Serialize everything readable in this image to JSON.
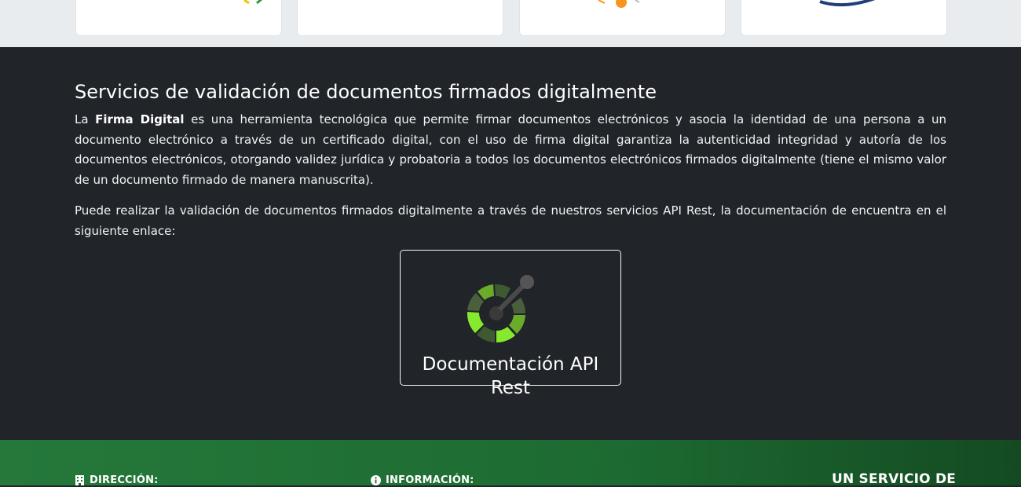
{
  "section": {
    "title": "Servicios de validación de documentos firmados digitalmente",
    "para1_prefix": "La ",
    "para1_bold": "Firma Digital",
    "para1_rest": " es una herramienta tecnológica que permite firmar documentos electrónicos y asocia la identidad de una persona a un documento electrónico a través de un certificado digital, con el uso de firma digital garantiza la autenticidad integridad y autoría de los documentos electrónicos, otorgando validez jurídica y probatoria a todos los documentos electrónicos firmados digitalmente (tiene el mismo valor de un documento firmado de manera manuscrita).",
    "para2": "Puede realizar la validación de documentos firmados digitalmente a través de nuestros servicios API Rest, la documentación de encuentra en el siguiente enlace:"
  },
  "api_button": {
    "label": "Documentación API Rest",
    "icon": "openapi-logo-icon"
  },
  "footer": {
    "address_heading": "DIRECCIÓN:",
    "address_icon": "building-icon",
    "info_heading": "INFORMACIÓN:",
    "info_icon": "info-circle-icon",
    "service_heading": "UN SERVICIO DE"
  },
  "colors": {
    "dark_bg": "#212529",
    "footer_green": "#1d6b32",
    "logo_green": "#85ea2d",
    "logo_dark": "#173647"
  }
}
